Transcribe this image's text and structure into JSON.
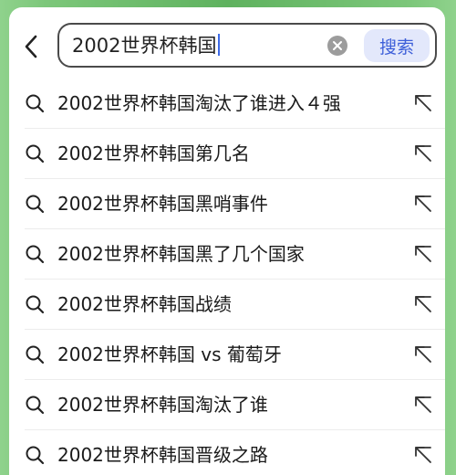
{
  "search": {
    "query": "2002世界杯韩国",
    "button_label": "搜索"
  },
  "suggestions": [
    "2002世界杯韩国淘汰了谁进入４强",
    "2002世界杯韩国第几名",
    "2002世界杯韩国黑哨事件",
    "2002世界杯韩国黑了几个国家",
    "2002世界杯韩国战绩",
    "2002世界杯韩国 vs 葡萄牙",
    "2002世界杯韩国淘汰了谁",
    "2002世界杯韩国晋级之路"
  ],
  "icons": {
    "back": "chevron-left-icon",
    "clear": "clear-circle-icon",
    "suggestion": "search-icon",
    "fill": "arrow-up-left-icon"
  },
  "colors": {
    "accent": "#3d5fd9",
    "search_button_bg": "#e3e8fb",
    "background": "#ffffff"
  }
}
